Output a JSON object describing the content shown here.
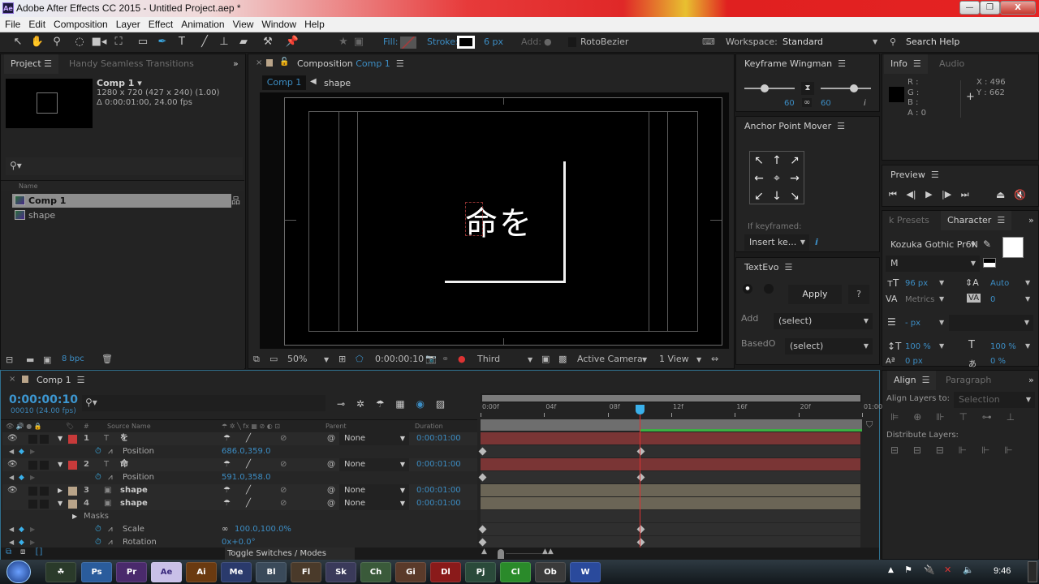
{
  "window": {
    "title": "Adobe After Effects CC 2015 - Untitled Project.aep *",
    "app_icon": "Ae",
    "min": "—",
    "max": "❐",
    "close": "X"
  },
  "menu": [
    "File",
    "Edit",
    "Composition",
    "Layer",
    "Effect",
    "Animation",
    "View",
    "Window",
    "Help"
  ],
  "toolbar": {
    "tools": [
      "selection-tool",
      "hand-tool",
      "zoom-tool",
      "rotation-tool",
      "camera-tool",
      "pan-behind-tool",
      "rectangle-tool",
      "pen-tool",
      "type-tool",
      "brush-tool",
      "clone-stamp-tool",
      "eraser-tool",
      "roto-brush-tool",
      "puppet-pin-tool"
    ],
    "fill_label": "Fill:",
    "stroke_label": "Stroke:",
    "stroke_width": "6 px",
    "add_label": "Add:",
    "rotobezier_label": "RotoBezier",
    "workspace_label": "Workspace:",
    "workspace_value": "Standard",
    "search_help": "Search Help"
  },
  "project": {
    "tab": "Project",
    "tab2": "Handy Seamless Transitions",
    "comp_name": "Comp 1 ▾",
    "comp_dims": "1280 x 720  (427 x 240) (1.00)",
    "comp_duration": "Δ 0:00:01:00, 24.00 fps",
    "col_name": "Name",
    "items": [
      {
        "label": "Comp 1",
        "selected": true
      },
      {
        "label": "shape",
        "selected": false
      }
    ],
    "bpc": "8 bpc"
  },
  "composition": {
    "tab_prefix": "Composition",
    "tab_name": "Comp 1",
    "breadcrumb": [
      "Comp 1",
      "shape"
    ],
    "canvas_text": "命を",
    "zoom": "50%",
    "timecode": "0:00:00:10",
    "resolution": "Third",
    "camera": "Active Camera",
    "views": "1 View"
  },
  "keyframe_wingman": {
    "title": "Keyframe Wingman",
    "left_value": "60",
    "right_value": "60",
    "info": "i"
  },
  "anchor_point_mover": {
    "title": "Anchor Point Mover",
    "arrows": [
      "↖",
      "↑",
      "↗",
      "←",
      "⌖",
      "→",
      "↙",
      "↓",
      "↘"
    ],
    "if_keyframed_label": "If keyframed:",
    "if_keyframed_value": "Insert ke...",
    "info": "i"
  },
  "textevo": {
    "title": "TextEvo",
    "apply": "Apply",
    "help": "?",
    "add_label": "Add",
    "add_value": "(select)",
    "based_label": "BasedO",
    "based_value": "(select)"
  },
  "info": {
    "tab": "Info",
    "tab2": "Audio",
    "r": "R :",
    "g": "G :",
    "b": "B :",
    "a": "A : 0",
    "x": "X : 496",
    "y": "Y : 662"
  },
  "preview": {
    "title": "Preview",
    "controls": [
      "⏮",
      "◀|",
      "▶",
      "|▶",
      "⏭"
    ]
  },
  "character": {
    "tab_prev": "k Presets",
    "tab": "Character",
    "font": "Kozuka Gothic Pr6N",
    "style": "M",
    "size": "96 px",
    "leading": "Auto",
    "kerning": "Metrics",
    "tracking": "0",
    "stroke_width": "- px",
    "vscale": "100 %",
    "hscale": "100 %",
    "baseline": "0 px",
    "tsume": "0 %"
  },
  "align": {
    "tab": "Align",
    "tab2": "Paragraph",
    "align_to_label": "Align Layers to:",
    "align_to_value": "Selection",
    "distribute_label": "Distribute Layers:"
  },
  "timeline": {
    "tab": "Comp 1",
    "timecode": "0:00:00:10",
    "timecode_sub": "00010 (24.00 fps)",
    "col_source": "Source Name",
    "col_parent": "Parent",
    "col_duration": "Duration",
    "ruler": [
      "0:00f",
      "04f",
      "08f",
      "12f",
      "16f",
      "20f",
      "01:00"
    ],
    "playhead_frame": 10,
    "total_frames": 24,
    "toggle_label": "Toggle Switches / Modes",
    "rows": [
      {
        "type": "layer",
        "num": "1",
        "name": "を",
        "label_color": "#c73a3a",
        "parent": "None",
        "duration": "0:00:01:00",
        "expanded": true,
        "bar_color": "#7a3535",
        "eye": true
      },
      {
        "type": "prop",
        "name": "Position",
        "value": "686.0,359.0",
        "keys": [
          0,
          10
        ]
      },
      {
        "type": "layer",
        "num": "2",
        "name": "命",
        "label_color": "#c73a3a",
        "parent": "None",
        "duration": "0:00:01:00",
        "expanded": true,
        "bar_color": "#7a3535",
        "eye": true
      },
      {
        "type": "prop",
        "name": "Position",
        "value": "591.0,358.0",
        "keys": [
          0,
          10
        ]
      },
      {
        "type": "layer",
        "num": "3",
        "name": "shape",
        "label_color": "#b9a489",
        "parent": "None",
        "duration": "0:00:01:00",
        "expanded": false,
        "bar_color": "#6b6556",
        "eye": true
      },
      {
        "type": "layer",
        "num": "4",
        "name": "shape",
        "label_color": "#b9a489",
        "parent": "None",
        "duration": "0:00:01:00",
        "expanded": true,
        "bar_color": "#6b6556",
        "eye": false
      },
      {
        "type": "group",
        "name": "Masks"
      },
      {
        "type": "prop",
        "name": "Scale",
        "value": "100.0,100.0%",
        "keys": [
          0,
          10
        ]
      },
      {
        "type": "prop",
        "name": "Rotation",
        "value": "0x+0.0°",
        "keys": [
          0,
          10
        ]
      }
    ]
  },
  "taskbar": {
    "apps": [
      "Ps",
      "Pr",
      "Ae",
      "Ai",
      "Me",
      "Bl",
      "Fl",
      "Sk",
      "Ch",
      "Gi",
      "Dl",
      "Pj",
      "Cl",
      "Ob",
      "W"
    ],
    "clock": "9:46"
  }
}
